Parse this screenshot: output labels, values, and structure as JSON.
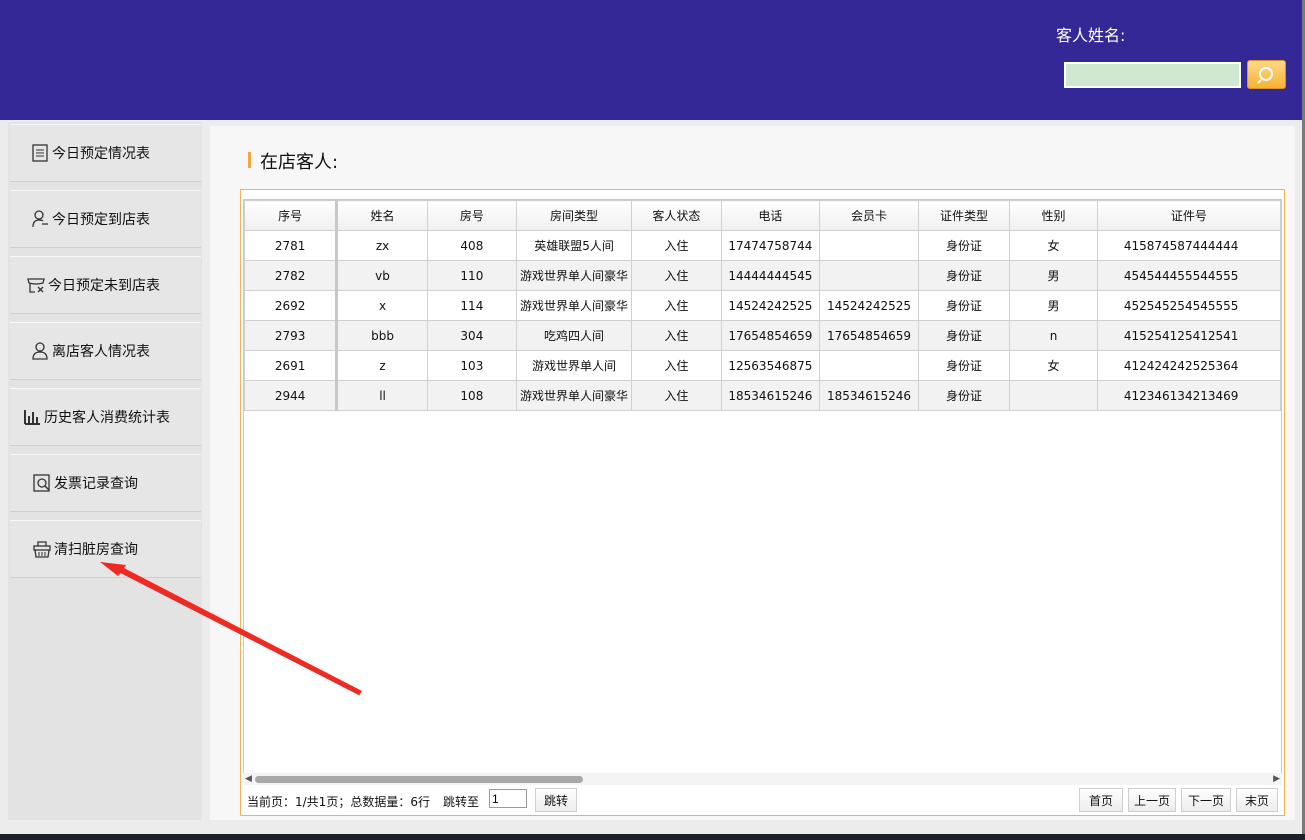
{
  "header": {
    "search_label": "客人姓名:",
    "search_value": "",
    "accent": "#332896"
  },
  "sidebar": {
    "items": [
      {
        "label": "今日预定情况表",
        "icon": "document-icon"
      },
      {
        "label": "今日预定到店表",
        "icon": "user-check-icon"
      },
      {
        "label": "今日预定未到店表",
        "icon": "store-cancel-icon"
      },
      {
        "label": "离店客人情况表",
        "icon": "user-icon"
      },
      {
        "label": "历史客人消费统计表",
        "icon": "bar-chart-icon"
      },
      {
        "label": "发票记录查询",
        "icon": "invoice-search-icon"
      },
      {
        "label": "清扫脏房查询",
        "icon": "cleaning-basket-icon"
      }
    ]
  },
  "main": {
    "title": "在店客人:",
    "columns": [
      "序号",
      "姓名",
      "房号",
      "房间类型",
      "客人状态",
      "电话",
      "会员卡",
      "证件类型",
      "性别",
      "证件号"
    ],
    "rows": [
      [
        "2781",
        "zx",
        "408",
        "英雄联盟5人间",
        "入住",
        "17474758744",
        "",
        "身份证",
        "女",
        "415874587444444"
      ],
      [
        "2782",
        "vb",
        "110",
        "游戏世界单人间豪华",
        "入住",
        "14444444545",
        "",
        "身份证",
        "男",
        "454544455544555"
      ],
      [
        "2692",
        "x",
        "114",
        "游戏世界单人间豪华",
        "入住",
        "14524242525",
        "14524242525",
        "身份证",
        "男",
        "452545254545555"
      ],
      [
        "2793",
        "bbb",
        "304",
        "吃鸡四人间",
        "入住",
        "17654854659",
        "17654854659",
        "身份证",
        "n",
        "415254125412541"
      ],
      [
        "2691",
        "z",
        "103",
        "游戏世界单人间",
        "入住",
        "12563546875",
        "",
        "身份证",
        "女",
        "412424242525364"
      ],
      [
        "2944",
        "ll",
        "108",
        "游戏世界单人间豪华",
        "入住",
        "18534615246",
        "18534615246",
        "身份证",
        "",
        "412346134213469"
      ]
    ],
    "pager": {
      "info": "当前页：1/共1页；总数据量：6行",
      "jump_label": "跳转至",
      "jump_value": "1",
      "jump_button": "跳转",
      "first": "首页",
      "prev": "上一页",
      "next": "下一页",
      "last": "末页"
    }
  }
}
